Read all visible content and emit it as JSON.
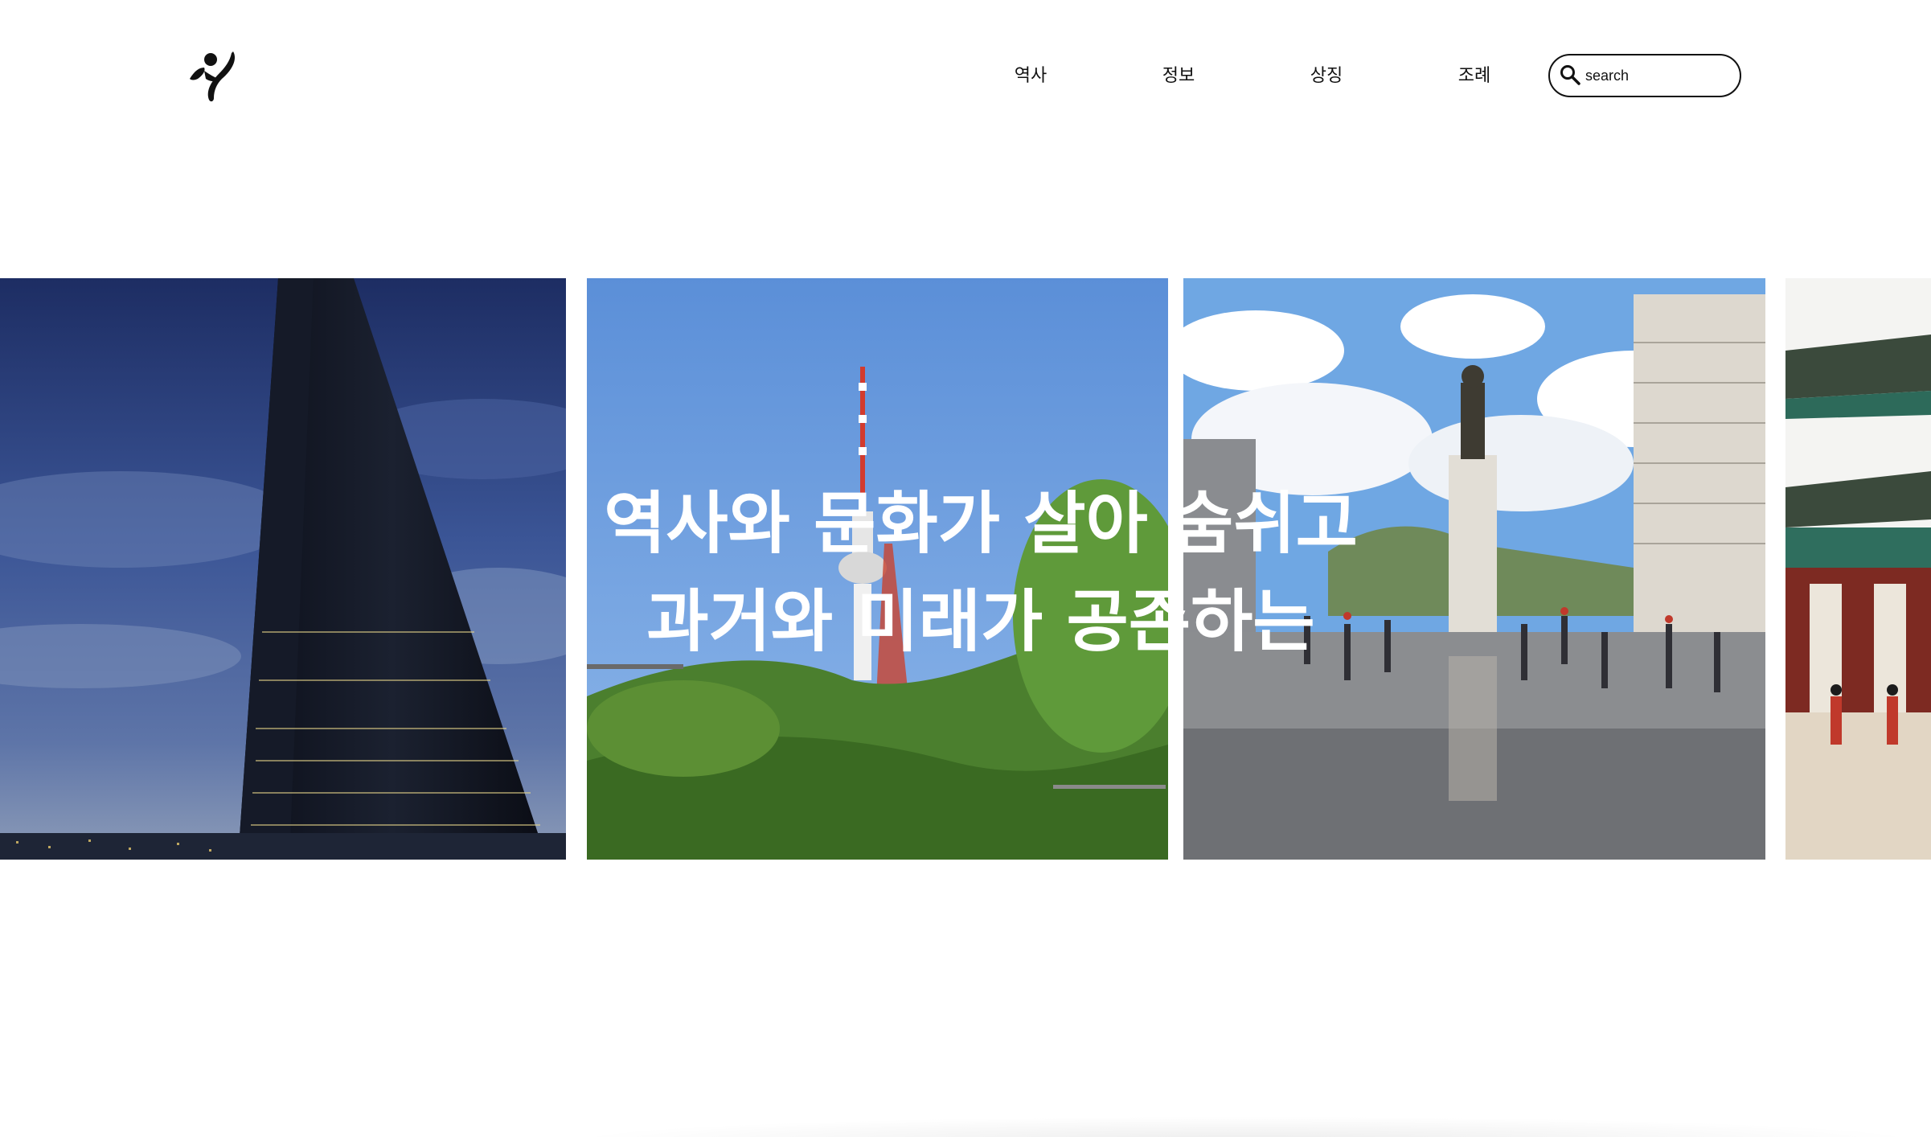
{
  "header": {
    "logo_icon": "seoul-brush-logo-icon",
    "nav": [
      {
        "label": "역사"
      },
      {
        "label": "정보"
      },
      {
        "label": "상징"
      },
      {
        "label": "조례"
      }
    ],
    "search": {
      "placeholder": "search",
      "icon": "search-icon"
    }
  },
  "hero": {
    "headline_line1": "역사와 문화가 살아 숨쉬고",
    "headline_line2": "과거와 미래가 공존하는"
  },
  "gallery": {
    "photos": [
      {
        "name": "skyscraper-photo",
        "subject": "tall glass skyscraper at dusk"
      },
      {
        "name": "namsan-tower-photo",
        "subject": "N Seoul Tower on a green hill"
      },
      {
        "name": "gwanghwamun-square-photo",
        "subject": "statue in a city plaza with fountain"
      },
      {
        "name": "palace-gate-photo",
        "subject": "palace gate with guards"
      }
    ]
  },
  "colors": {
    "text": "#111111",
    "background": "#ffffff",
    "headline": "#ffffff"
  }
}
